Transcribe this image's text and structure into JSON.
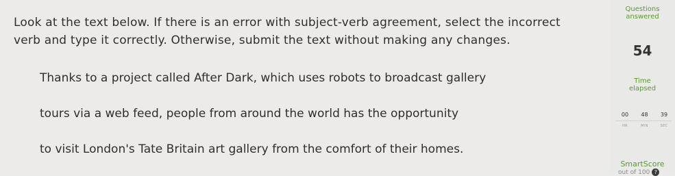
{
  "question": {
    "instructions": "Look at the text below. If there is an error with subject-verb agreement, select the incorrect verb and type it correctly. Otherwise, submit the text without making any changes.",
    "passage_lines": [
      "Thanks to a project called After Dark, which uses robots to broadcast gallery",
      "tours via a web feed, people from around the world has the opportunity",
      "to visit London's Tate Britain art gallery from the comfort of their homes."
    ]
  },
  "sidebar": {
    "questions_label_1": "Questions",
    "questions_label_2": "answered",
    "questions_answered": "54",
    "time_label_1": "Time",
    "time_label_2": "elapsed",
    "timer": {
      "hours": "00",
      "minutes": "48",
      "seconds": "39",
      "hours_unit": "HR",
      "minutes_unit": "MIN",
      "seconds_unit": "SEC"
    },
    "smartscore_label": "SmartScore",
    "smartscore_sub": "out of 100",
    "help_icon_glyph": "?"
  },
  "colors": {
    "accent_green": "#5a9a2e",
    "background": "#ecebea"
  }
}
